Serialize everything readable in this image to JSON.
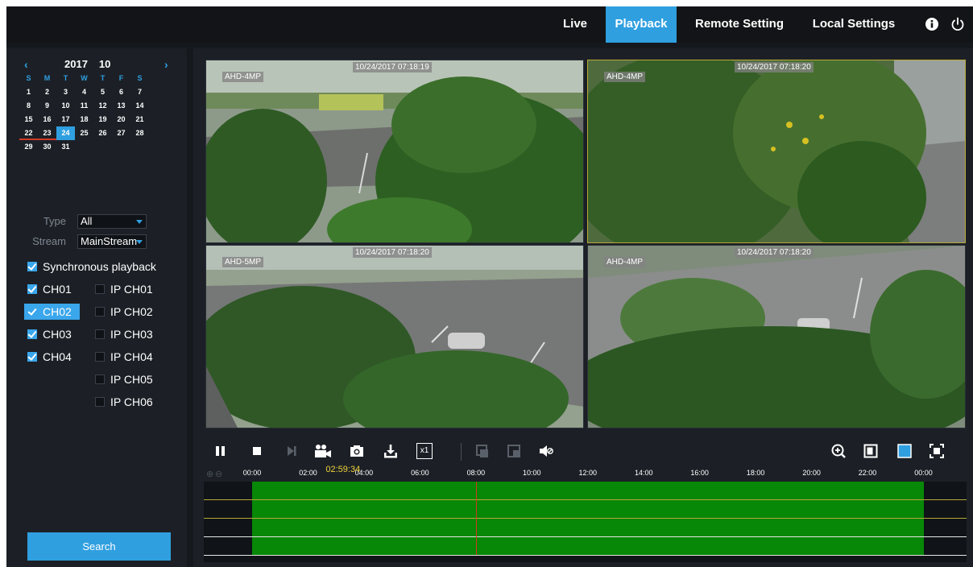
{
  "nav": {
    "items": [
      {
        "label": "Live",
        "active": false
      },
      {
        "label": "Playback",
        "active": true
      },
      {
        "label": "Remote Setting",
        "active": false
      },
      {
        "label": "Local Settings",
        "active": false
      }
    ],
    "icons": [
      "info-icon",
      "power-icon"
    ],
    "accent_color": "#2f9fe0"
  },
  "calendar": {
    "year": "2017",
    "month": "10",
    "weekdays": [
      "S",
      "M",
      "T",
      "W",
      "T",
      "F",
      "S"
    ],
    "days": [
      "1",
      "2",
      "3",
      "4",
      "5",
      "6",
      "7",
      "8",
      "9",
      "10",
      "11",
      "12",
      "13",
      "14",
      "15",
      "16",
      "17",
      "18",
      "19",
      "20",
      "21",
      "22",
      "23",
      "24",
      "25",
      "26",
      "27",
      "28",
      "29",
      "30",
      "31"
    ],
    "selected_day": "24",
    "record_days": [
      "22",
      "23"
    ]
  },
  "filters": {
    "type_label": "Type",
    "type_value": "All",
    "stream_label": "Stream",
    "stream_value": "MainStream"
  },
  "sync_playback": {
    "label": "Synchronous playback",
    "checked": true
  },
  "channels": [
    {
      "label": "CH01",
      "checked": true,
      "highlight": false
    },
    {
      "label": "CH02",
      "checked": true,
      "highlight": true
    },
    {
      "label": "CH03",
      "checked": true,
      "highlight": false
    },
    {
      "label": "CH04",
      "checked": true,
      "highlight": false
    }
  ],
  "ip_channels": [
    {
      "label": "IP CH01",
      "checked": false
    },
    {
      "label": "IP CH02",
      "checked": false
    },
    {
      "label": "IP CH03",
      "checked": false
    },
    {
      "label": "IP CH04",
      "checked": false
    },
    {
      "label": "IP CH05",
      "checked": false
    },
    {
      "label": "IP CH06",
      "checked": false
    }
  ],
  "search_label": "Search",
  "videos": [
    {
      "name": "AHD-4MP",
      "time": "10/24/2017 07:18:19",
      "selected": false
    },
    {
      "name": "AHD-4MP",
      "time": "10/24/2017 07:18:20",
      "selected": true
    },
    {
      "name": "AHD-5MP",
      "time": "10/24/2017 07:18:20",
      "selected": false
    },
    {
      "name": "AHD-4MP",
      "time": "10/24/2017 07:18:20",
      "selected": false
    }
  ],
  "toolbar": {
    "left_icons": [
      "pause-icon",
      "stop-icon",
      "step-forward-icon",
      "video-clip-icon",
      "snapshot-icon",
      "download-icon",
      "speed-x1-icon"
    ],
    "speed_label": "x1",
    "mid_icons": [
      "split-1-icon",
      "split-2-icon",
      "audio-mute-icon"
    ],
    "right_icons": [
      "zoom-in-icon",
      "single-view-icon",
      "quad-view-icon",
      "fullscreen-icon"
    ]
  },
  "timeline": {
    "tick_labels": [
      "00:00",
      "02:00",
      "04:00",
      "06:00",
      "08:00",
      "10:00",
      "12:00",
      "14:00",
      "16:00",
      "18:00",
      "20:00",
      "22:00",
      "00:00"
    ],
    "cursor_time": "02:59:34",
    "record_start_hour": 0,
    "record_end_hour": 24,
    "playhead_hour": 8
  }
}
